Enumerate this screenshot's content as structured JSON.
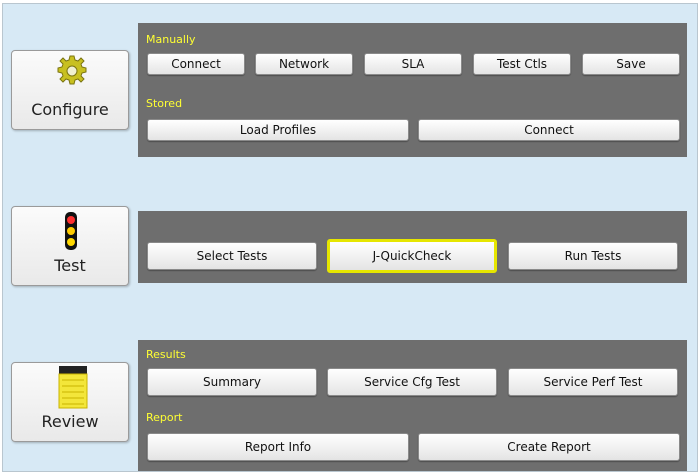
{
  "sidebar": {
    "configure": {
      "label": "Configure",
      "icon": "gear-icon"
    },
    "test": {
      "label": "Test",
      "icon": "traffic-light-icon"
    },
    "review": {
      "label": "Review",
      "icon": "notepad-icon"
    }
  },
  "configure_panel": {
    "manually_label": "Manually",
    "manual_buttons": [
      "Connect",
      "Network",
      "SLA",
      "Test Ctls",
      "Save"
    ],
    "stored_label": "Stored",
    "stored_buttons": [
      "Load Profiles",
      "Connect"
    ]
  },
  "test_panel": {
    "buttons": [
      "Select Tests",
      "J-QuickCheck",
      "Run Tests"
    ],
    "selected": "J-QuickCheck"
  },
  "review_panel": {
    "results_label": "Results",
    "results_buttons": [
      "Summary",
      "Service Cfg Test",
      "Service Perf Test"
    ],
    "report_label": "Report",
    "report_buttons": [
      "Report Info",
      "Create Report"
    ]
  },
  "colors": {
    "background": "#d7e9f5",
    "panel": "#6e6e6e",
    "section_label": "#ffff33",
    "selected_border": "#e6e600"
  }
}
